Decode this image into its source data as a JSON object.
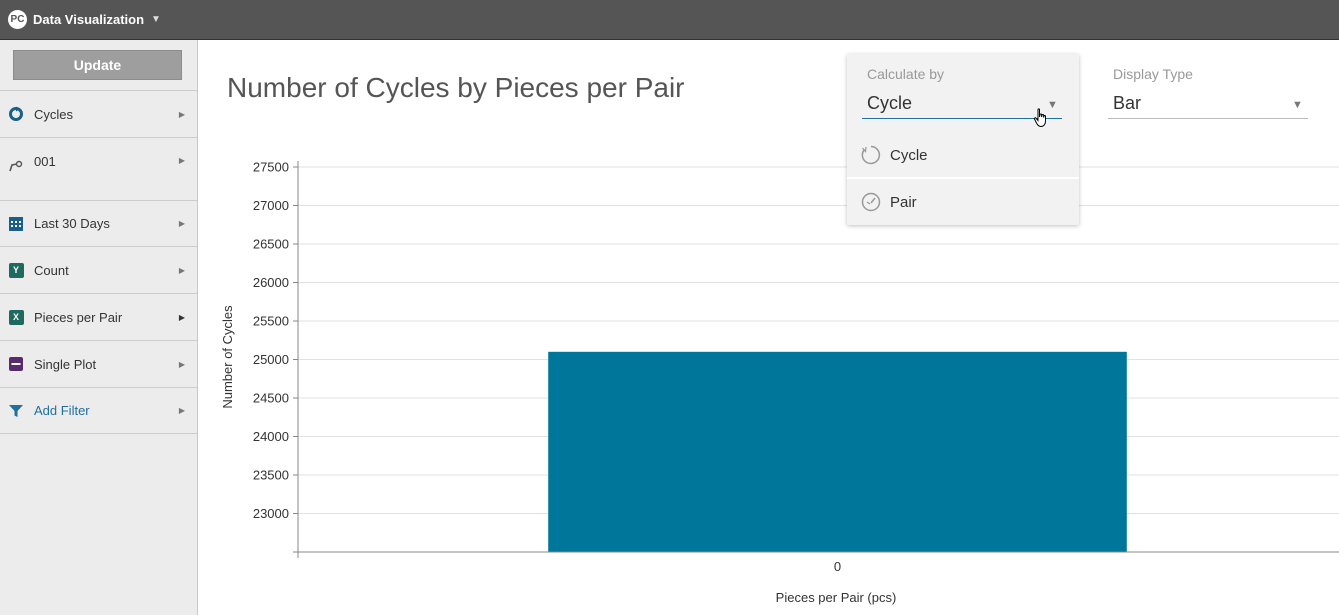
{
  "app": {
    "title": "Data Visualization",
    "logo_text": "PC"
  },
  "sidebar": {
    "update_label": "Update",
    "items": [
      {
        "label": "Cycles",
        "icon": "refresh-circle-icon"
      },
      {
        "label": "001",
        "icon": "machine-icon"
      },
      {
        "label": "Last 30 Days",
        "icon": "calendar-icon"
      },
      {
        "label": "Count",
        "icon": "y-axis-icon",
        "badge": "Y"
      },
      {
        "label": "Pieces per Pair",
        "icon": "x-axis-icon",
        "badge": "X"
      },
      {
        "label": "Single Plot",
        "icon": "single-plot-icon"
      },
      {
        "label": "Add Filter",
        "icon": "filter-icon"
      }
    ]
  },
  "main": {
    "title": "Number of Cycles by Pieces per Pair",
    "calculate_by": {
      "label": "Calculate by",
      "value": "Cycle",
      "options": [
        "Cycle",
        "Pair"
      ]
    },
    "display_type": {
      "label": "Display Type",
      "value": "Bar"
    }
  },
  "colors": {
    "bar": "#00769a",
    "accent_line": "#1f6f9f",
    "topbar": "#555555"
  },
  "chart_data": {
    "type": "bar",
    "title": "Number of Cycles by Pieces per Pair",
    "categories": [
      "0"
    ],
    "values": [
      25100
    ],
    "xlabel": "Pieces per Pair (pcs)",
    "ylabel": "Number of Cycles",
    "ylim": [
      22500,
      27500
    ],
    "yticks": [
      23000,
      23500,
      24000,
      24500,
      25000,
      25500,
      26000,
      26500,
      27000,
      27500
    ],
    "grid": true
  }
}
